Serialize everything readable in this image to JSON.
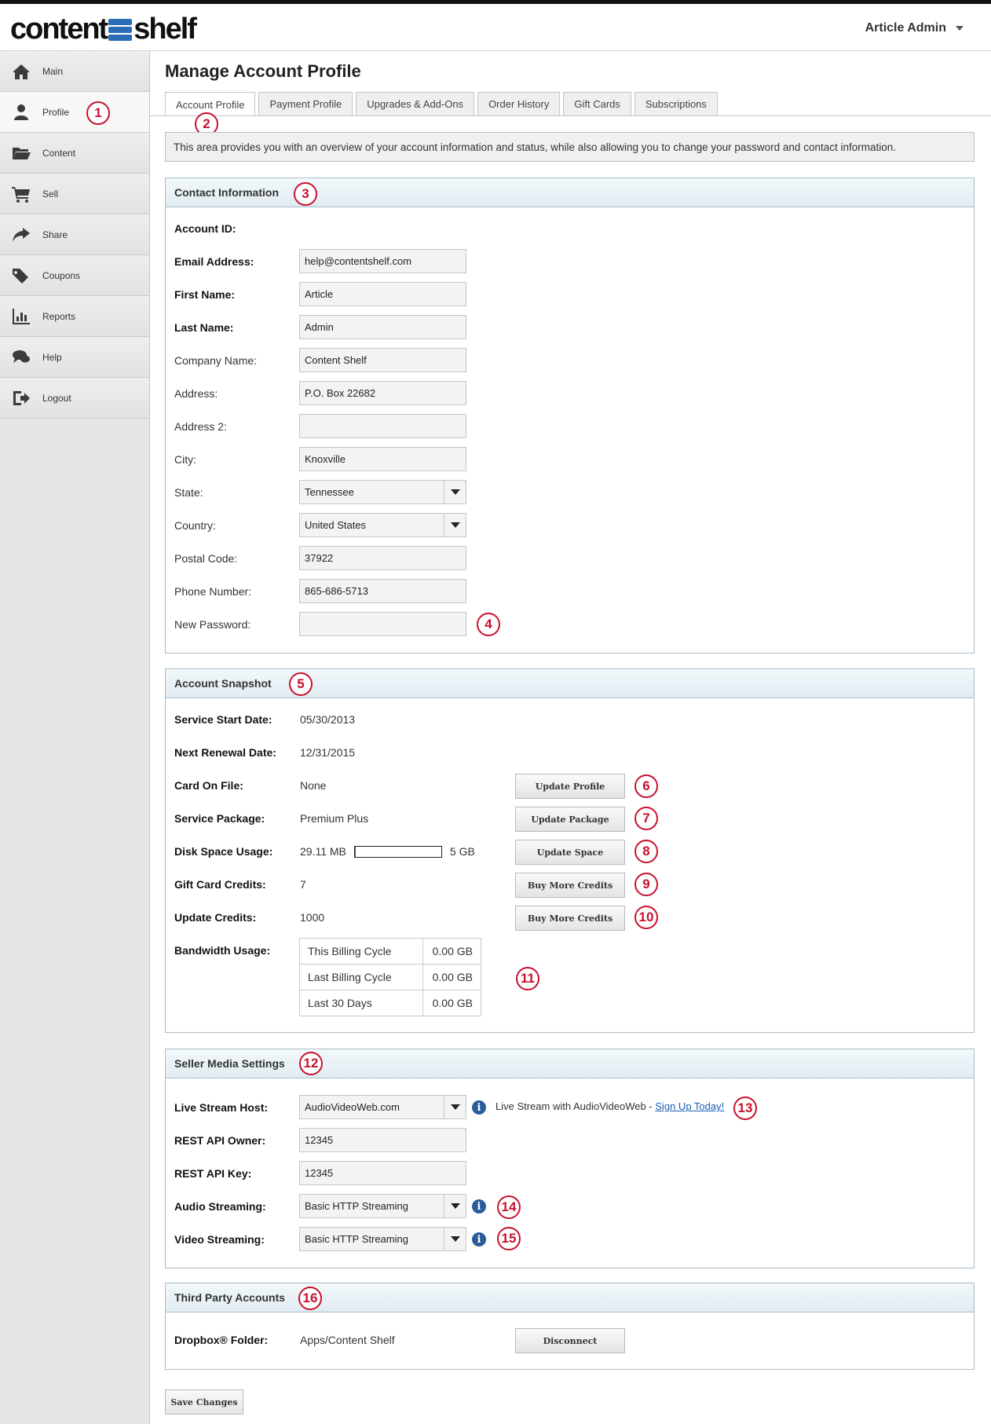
{
  "header": {
    "logo_left": "content",
    "logo_right": "shelf",
    "user_name": "Article Admin"
  },
  "sidebar": {
    "items": [
      {
        "label": "Main",
        "icon": "home-icon"
      },
      {
        "label": "Profile",
        "icon": "user-icon"
      },
      {
        "label": "Content",
        "icon": "folder-icon"
      },
      {
        "label": "Sell",
        "icon": "cart-icon"
      },
      {
        "label": "Share",
        "icon": "share-icon"
      },
      {
        "label": "Coupons",
        "icon": "tags-icon"
      },
      {
        "label": "Reports",
        "icon": "bar-chart-icon"
      },
      {
        "label": "Help",
        "icon": "chat-icon"
      },
      {
        "label": "Logout",
        "icon": "logout-icon"
      }
    ]
  },
  "page": {
    "title": "Manage Account Profile",
    "tabs": [
      "Account Profile",
      "Payment Profile",
      "Upgrades & Add-Ons",
      "Order History",
      "Gift Cards",
      "Subscriptions"
    ],
    "intro": "This area provides you with an overview of your account information and status, while also allowing you to change your password and contact information."
  },
  "contact": {
    "title": "Contact Information",
    "account_id_label": "Account ID:",
    "email_label": "Email Address:",
    "email": "help@contentshelf.com",
    "first_label": "First Name:",
    "first": "Article",
    "last_label": "Last Name:",
    "last": "Admin",
    "company_label": "Company Name:",
    "company": "Content Shelf",
    "address_label": "Address:",
    "address": "P.O. Box 22682",
    "address2_label": "Address 2:",
    "address2": "",
    "city_label": "City:",
    "city": "Knoxville",
    "state_label": "State:",
    "state": "Tennessee",
    "country_label": "Country:",
    "country": "United States",
    "postal_label": "Postal Code:",
    "postal": "37922",
    "phone_label": "Phone Number:",
    "phone": "865-686-5713",
    "password_label": "New Password:",
    "password": ""
  },
  "snapshot": {
    "title": "Account Snapshot",
    "start_label": "Service Start Date:",
    "start": "05/30/2013",
    "renewal_label": "Next Renewal Date:",
    "renewal": "12/31/2015",
    "card_label": "Card On File:",
    "card": "None",
    "card_button": "Update Profile",
    "package_label": "Service Package:",
    "package": "Premium Plus",
    "package_button": "Update Package",
    "disk_label": "Disk Space Usage:",
    "disk_used": "29.11 MB",
    "disk_total": "5 GB",
    "disk_fraction": 0.006,
    "disk_button": "Update Space",
    "gift_label": "Gift Card Credits:",
    "gift": "7",
    "gift_button": "Buy More Credits",
    "update_label": "Update Credits:",
    "update": "1000",
    "update_button": "Buy More Credits",
    "bandwidth_label": "Bandwidth Usage:",
    "bandwidth": [
      {
        "period": "This Billing Cycle",
        "value": "0.00 GB"
      },
      {
        "period": "Last Billing Cycle",
        "value": "0.00 GB"
      },
      {
        "period": "Last 30 Days",
        "value": "0.00 GB"
      }
    ]
  },
  "seller": {
    "title": "Seller Media Settings",
    "host_label": "Live Stream Host:",
    "host": "AudioVideoWeb.com",
    "host_note": "Live Stream with AudioVideoWeb - ",
    "host_link": "Sign Up Today!",
    "owner_label": "REST API Owner:",
    "owner": "12345",
    "key_label": "REST API Key:",
    "key": "12345",
    "audio_label": "Audio Streaming:",
    "audio": "Basic HTTP Streaming",
    "video_label": "Video Streaming:",
    "video": "Basic HTTP Streaming"
  },
  "third_party": {
    "title": "Third Party Accounts",
    "dropbox_label": "Dropbox® Folder:",
    "dropbox": "Apps/Content Shelf",
    "disconnect": "Disconnect"
  },
  "save_label": "Save Changes",
  "callouts": [
    "1",
    "2",
    "3",
    "4",
    "5",
    "6",
    "7",
    "8",
    "9",
    "10",
    "11",
    "12",
    "13",
    "14",
    "15",
    "16"
  ],
  "colors": {
    "accent": "#2a6db5",
    "callout": "#c8102e",
    "panel_header": "#e1ecf2"
  }
}
